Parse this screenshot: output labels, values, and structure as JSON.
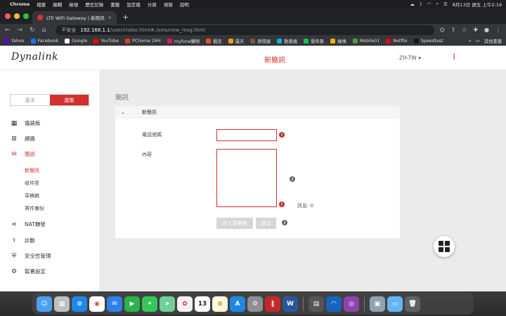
{
  "menubar": {
    "app_name": "Chrome",
    "items": [
      "檔案",
      "編輯",
      "檢視",
      "歷史記錄",
      "書籤",
      "設定檔",
      "分頁",
      "視窗",
      "說明"
    ],
    "datetime": "8月13日 週五 上午2:19"
  },
  "browser": {
    "tab_title": "LTE WiFi Gateway | 新簡訊",
    "insecure_label": "不安全",
    "url_host": "192.168.1.1",
    "url_path": "/user/index.html#./sms/new_msg.html",
    "bookmarks": [
      {
        "label": "Yahoo",
        "color": "#6001d2"
      },
      {
        "label": "Facebook",
        "color": "#1877f2"
      },
      {
        "label": "Google",
        "color": "#ffffff"
      },
      {
        "label": "YouTube",
        "color": "#ff0000"
      },
      {
        "label": "PChome 24H",
        "color": "#e53935"
      },
      {
        "label": "myfone購物",
        "color": "#d81b60"
      },
      {
        "label": "蝦皮",
        "color": "#ee4d2d"
      },
      {
        "label": "露天",
        "color": "#f39c12"
      },
      {
        "label": "原價屋",
        "color": "#795548"
      },
      {
        "label": "動畫瘋",
        "color": "#00b4d8"
      },
      {
        "label": "愛奇藝",
        "color": "#00c853"
      },
      {
        "label": "燒埆",
        "color": "#ffb300"
      },
      {
        "label": "Mobile01",
        "color": "#43a047"
      },
      {
        "label": "Netflix",
        "color": "#e50914"
      },
      {
        "label": "Speedtest",
        "color": "#141526"
      }
    ],
    "bookmarks_overflow": "»",
    "other_bookmarks": "其他書籤"
  },
  "header": {
    "logo": "Dynalink",
    "title": "新簡訊",
    "language": "ZH-TW"
  },
  "sidebar": {
    "mode_basic": "基本",
    "mode_advanced": "進階",
    "items": [
      {
        "label": "儀錶板",
        "icon": "dashboard-icon"
      },
      {
        "label": "網路",
        "icon": "network-icon"
      },
      {
        "label": "簡訊",
        "icon": "envelope-icon"
      },
      {
        "label": "NAT轉發",
        "icon": "share-icon"
      },
      {
        "label": "診斷",
        "icon": "stethoscope-icon"
      },
      {
        "label": "安全性管理",
        "icon": "shield-icon"
      },
      {
        "label": "裝置設定",
        "icon": "gear-icon"
      }
    ],
    "sms_subitems": [
      "新簡訊",
      "收件匣",
      "草稿箱",
      "寄件備份"
    ]
  },
  "main": {
    "section_title": "簡訊",
    "card_title": "新簡訊",
    "phone_label": "電話號碼",
    "phone_value": "",
    "content_label": "內容",
    "content_value": "",
    "counter": "訊息: 0",
    "save_draft_label": "存入草稿箱",
    "send_label": "送出"
  },
  "colors": {
    "accent": "#d32f2f",
    "main_bg": "#ebebeb",
    "disabled_button": "#d6d6d6"
  }
}
